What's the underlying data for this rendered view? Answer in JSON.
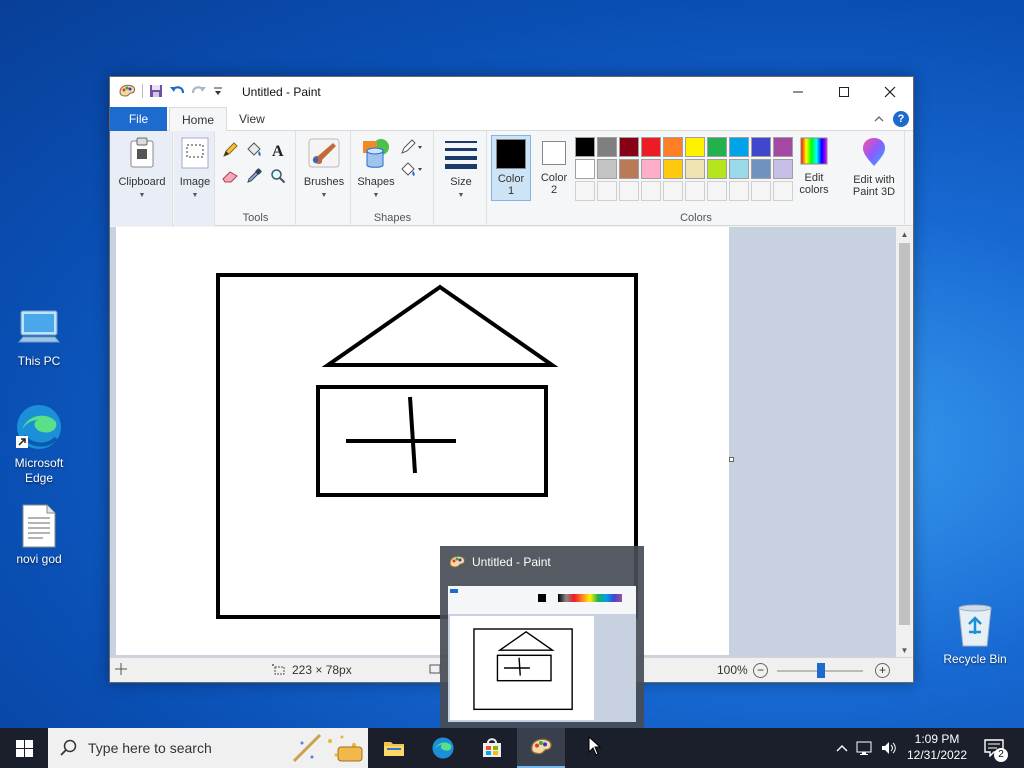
{
  "desktop": {
    "icons": [
      {
        "label": "This PC"
      },
      {
        "label": "Microsoft Edge"
      },
      {
        "label": "novi god"
      },
      {
        "label": "Recycle Bin"
      }
    ]
  },
  "window": {
    "title": "Untitled - Paint",
    "tabs": {
      "file": "File",
      "home": "Home",
      "view": "View"
    },
    "ribbon": {
      "clipboard": "Clipboard",
      "image": "Image",
      "tools": "Tools",
      "brushes": "Brushes",
      "shapes_button": "Shapes",
      "shapes_group": "Shapes",
      "size": "Size",
      "color1": [
        "Color",
        "1"
      ],
      "color2": [
        "Color",
        "2"
      ],
      "colors_group": "Colors",
      "edit_colors": [
        "Edit",
        "colors"
      ],
      "paint3d": [
        "Edit with",
        "Paint 3D"
      ]
    },
    "palette": {
      "row1": [
        "#000000",
        "#7f7f7f",
        "#880015",
        "#ed1c24",
        "#ff7f27",
        "#fff200",
        "#22b14c",
        "#00a2e8",
        "#3f48cc",
        "#a349a4"
      ],
      "row2": [
        "#ffffff",
        "#c3c3c3",
        "#b97a57",
        "#ffaec9",
        "#ffc90e",
        "#efe4b0",
        "#b5e61d",
        "#99d9ea",
        "#7092be",
        "#c8bfe7"
      ]
    },
    "status": {
      "selection_size": "223 × 78px",
      "zoom": "100%"
    }
  },
  "preview": {
    "title": "Untitled - Paint"
  },
  "taskbar": {
    "search_placeholder": "Type here to search",
    "time": "1:09 PM",
    "date": "12/31/2022",
    "notification_count": "2"
  }
}
